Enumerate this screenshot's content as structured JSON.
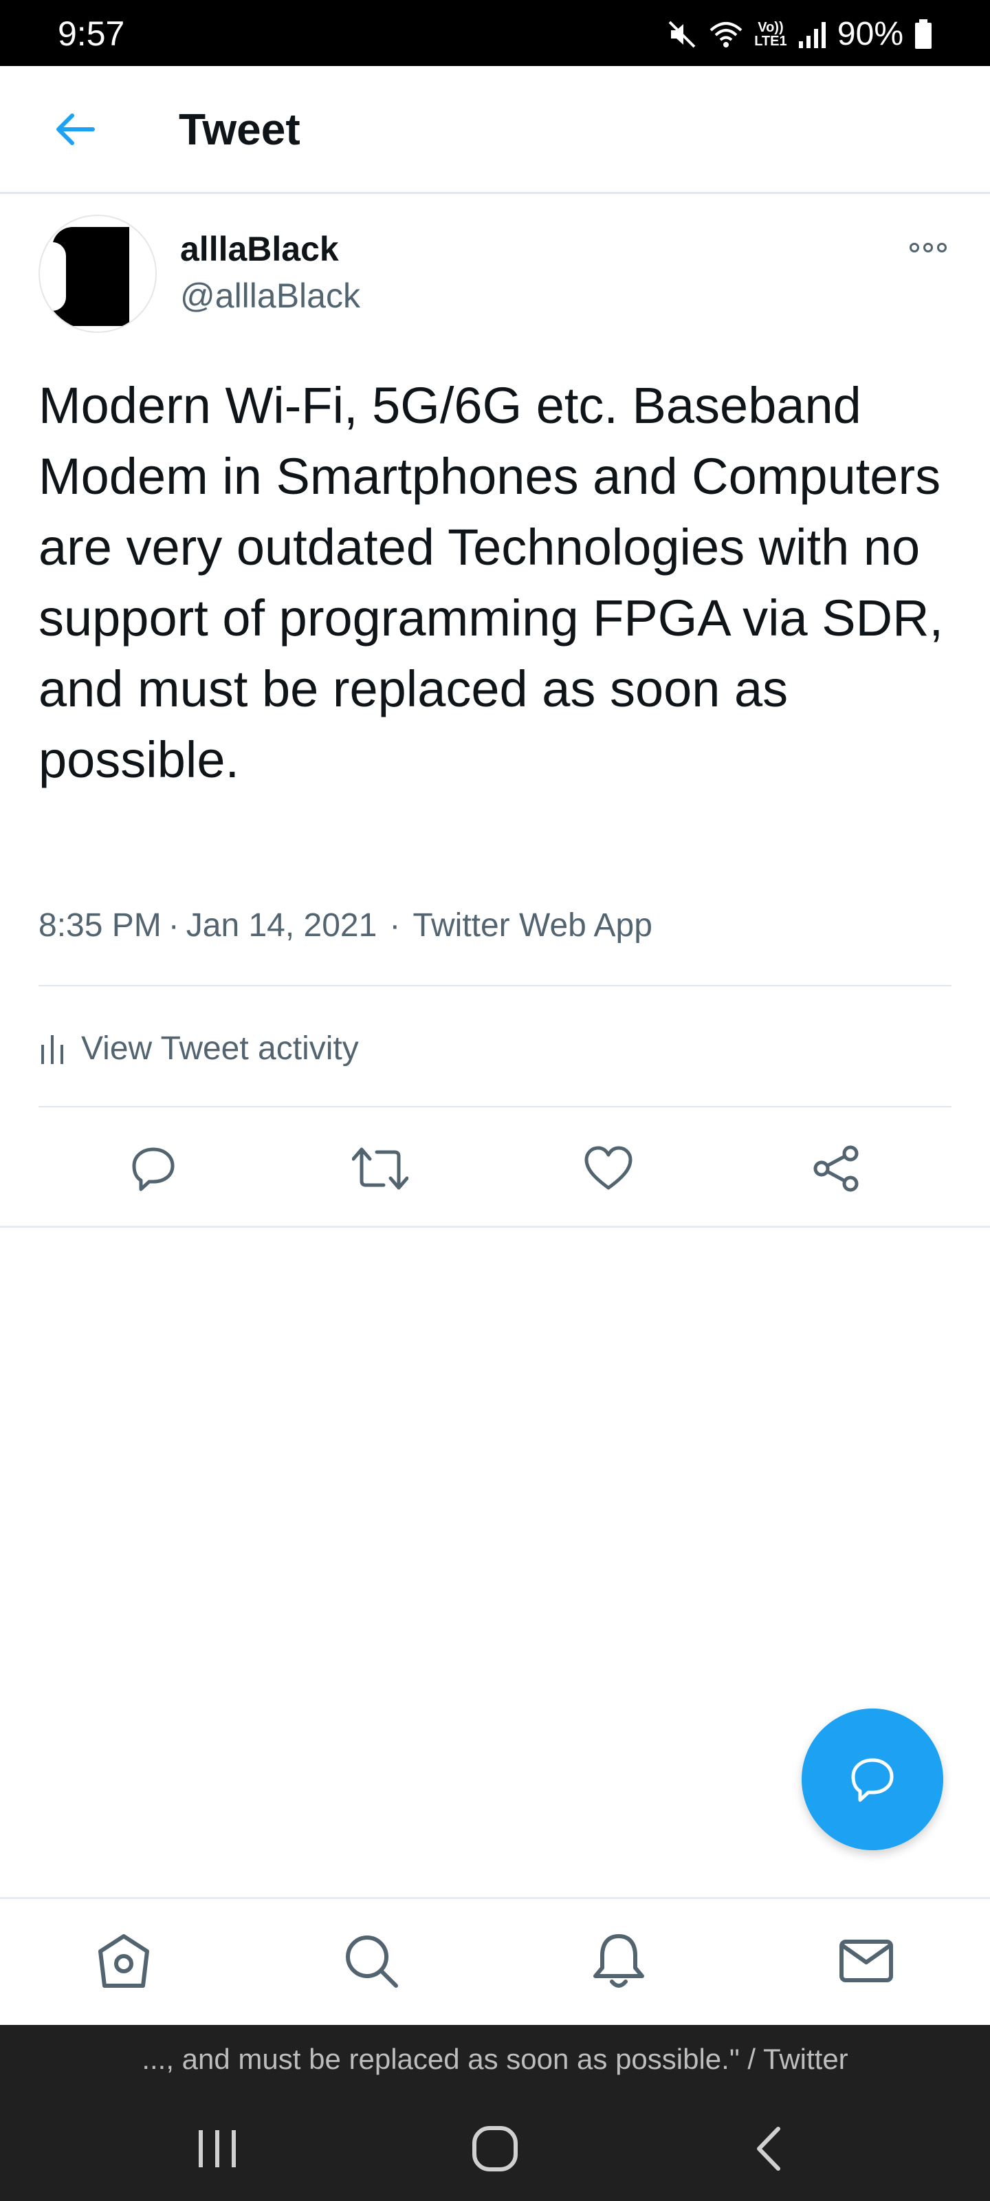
{
  "status_bar": {
    "time": "9:57",
    "network_label": "Vo)) LTE1",
    "battery": "90%"
  },
  "header": {
    "title": "Tweet"
  },
  "tweet": {
    "author_name": "alllaBlack",
    "author_handle": "@alllaBlack",
    "text": "Modern Wi-Fi, 5G/6G etc. Baseband Modem in Smartphones and Computers are very outdated Technologies with no support of programming FPGA via SDR, and must be replaced as soon as possible.",
    "time": "8:35 PM",
    "date": "Jan 14, 2021",
    "source": "Twitter Web App",
    "activity_label": "View Tweet activity"
  },
  "actions": [
    "reply",
    "retweet",
    "like",
    "share"
  ],
  "bottom_nav": [
    "home",
    "search",
    "notifications",
    "messages"
  ],
  "system_bar": {
    "caption": "..., and must be replaced as soon as possible.\" / Twitter"
  },
  "colors": {
    "accent": "#1da1f2",
    "text_primary": "#0f1419",
    "text_secondary": "#536471",
    "divider": "#e1e8ed",
    "system_bar": "#202020"
  }
}
